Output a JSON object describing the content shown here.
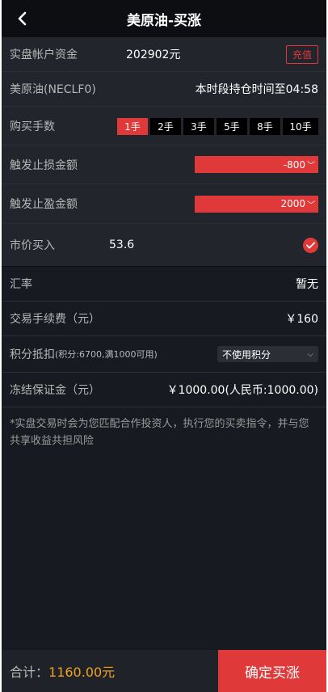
{
  "header": {
    "title": "美原油-买涨"
  },
  "account": {
    "label": "实盘帐户资金",
    "value": "202902元",
    "recharge_label": "充值"
  },
  "product": {
    "name": "美原油(NECLF0)",
    "hold_notice": "本时段持仓时间至04:58"
  },
  "lots": {
    "label": "购买手数",
    "options": [
      "1手",
      "2手",
      "3手",
      "5手",
      "8手",
      "10手"
    ],
    "selected": "1手"
  },
  "stop_loss": {
    "label": "触发止损金额",
    "value": "-800"
  },
  "take_profit": {
    "label": "触发止盈金额",
    "value": "2000"
  },
  "market_buy": {
    "label": "市价买入",
    "price": "53.6",
    "checked": true
  },
  "exchange_rate": {
    "label": "汇率",
    "value": "暂无"
  },
  "fee": {
    "label": "交易手续费（元）",
    "value": "￥160"
  },
  "points": {
    "label": "积分抵扣",
    "detail": "(积分:6700,满1000可用)",
    "option": "不使用积分"
  },
  "margin": {
    "label": "冻结保证金（元）",
    "value": "￥1000.00(人民币:1000.00)"
  },
  "notice": "*实盘交易时会为您匹配合作投资人，执行您的买卖指令，并与您共享收益共担风险",
  "footer": {
    "total_label": "合计：",
    "total_value": "1160.00元",
    "confirm_label": "确定买涨"
  },
  "colors": {
    "accent": "#e0393a",
    "total": "#f0a31a",
    "bg": "#171a20"
  }
}
